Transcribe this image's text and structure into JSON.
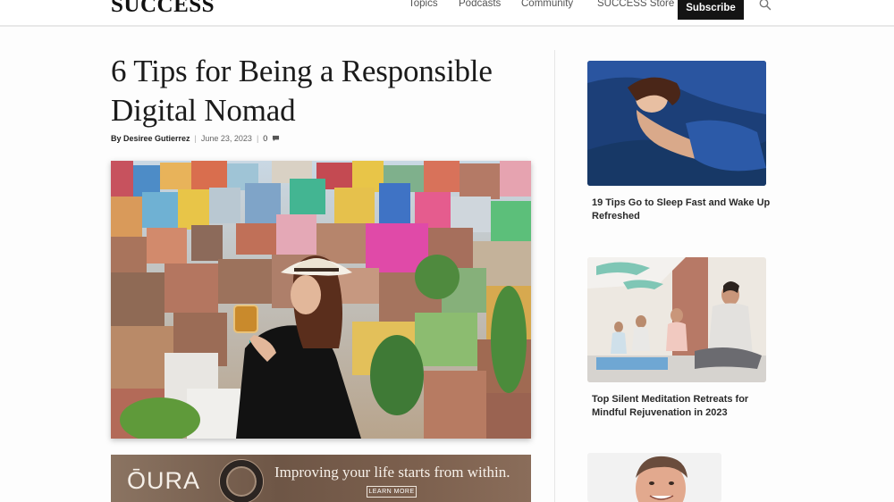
{
  "header": {
    "logo": "SUCCESS",
    "nav": [
      "Topics",
      "Podcasts",
      "Community",
      "SUCCESS Store"
    ],
    "subscribe_label": "Subscribe",
    "search_icon": "search-icon"
  },
  "article": {
    "title": "6 Tips for Being a Responsible Digital Nomad",
    "author": "By Desiree Gutierrez",
    "date": "June 23, 2023",
    "comment_count": "0",
    "comment_icon": "comment-icon"
  },
  "ad": {
    "brand": "ŌURA",
    "headline": "Improving your life starts from within.",
    "cta": "LEARN MORE"
  },
  "sidebar": {
    "cards": [
      {
        "title": "19 Tips Go to Sleep Fast and Wake Up Refreshed"
      },
      {
        "title": "Top Silent Meditation Retreats for Mindful Rejuvenation in 2023"
      }
    ]
  },
  "colors": {
    "subscribe_bg": "#141414",
    "ad_bg": "#735b4a"
  }
}
